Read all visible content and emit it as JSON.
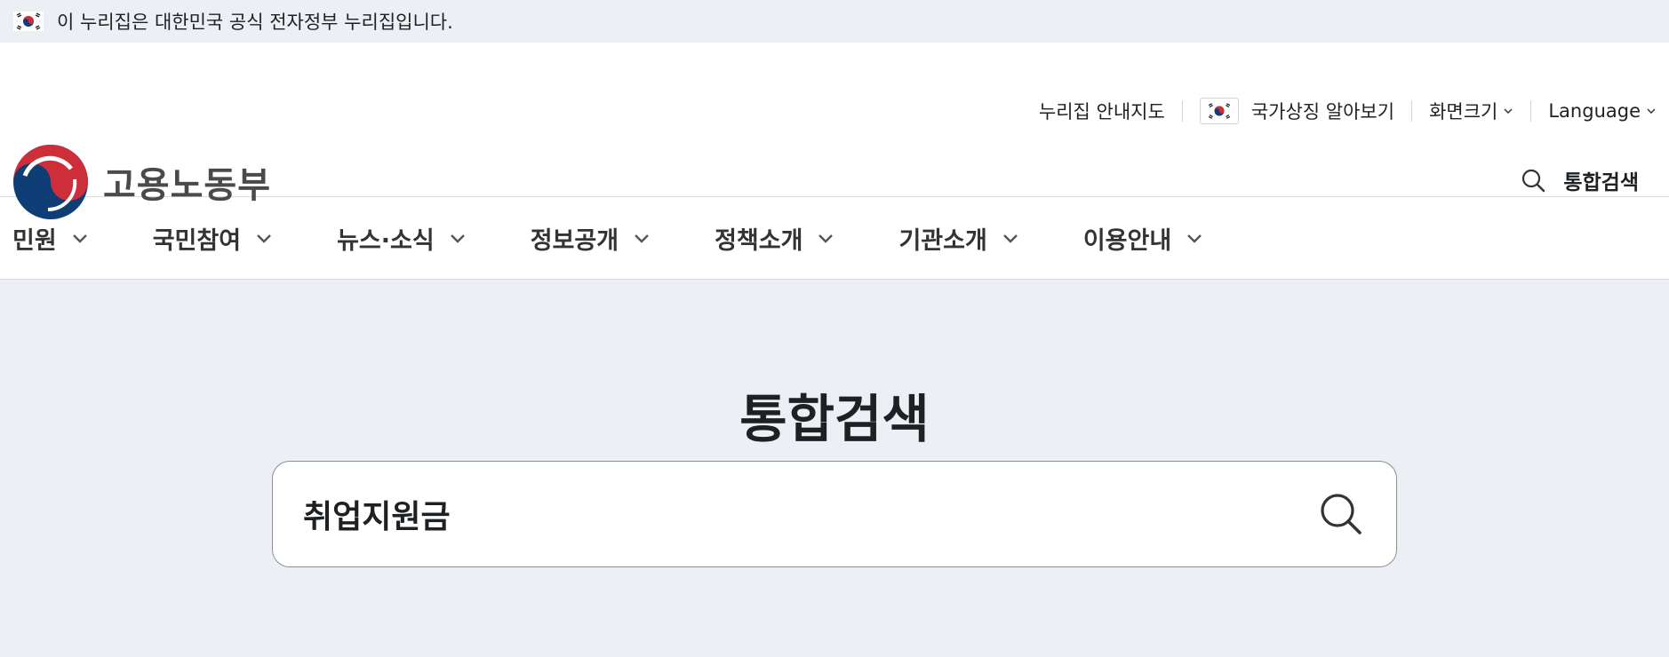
{
  "gov_banner": {
    "text": "이 누리집은 대한민국 공식 전자정부 누리집입니다.",
    "icon": "korea-flag-icon"
  },
  "utility": {
    "sitemap": "누리집 안내지도",
    "national_symbol": "국가상징 알아보기",
    "font_size": "화면크기",
    "language": "Language"
  },
  "logo": {
    "text": "고용노동부",
    "icon": "government-emblem-icon"
  },
  "header_search": {
    "label": "통합검색",
    "icon": "search-icon"
  },
  "nav": {
    "items": [
      {
        "label": "민원"
      },
      {
        "label": "국민참여"
      },
      {
        "label": "뉴스·소식"
      },
      {
        "label": "정보공개"
      },
      {
        "label": "정책소개"
      },
      {
        "label": "기관소개"
      },
      {
        "label": "이용안내"
      }
    ]
  },
  "main": {
    "title": "통합검색",
    "search": {
      "value": "취업지원금",
      "icon": "search-icon"
    }
  },
  "colors": {
    "banner_bg": "#eceff3",
    "emblem_red": "#cd2e3a",
    "emblem_blue": "#0f3d75",
    "text": "#1e2124"
  }
}
